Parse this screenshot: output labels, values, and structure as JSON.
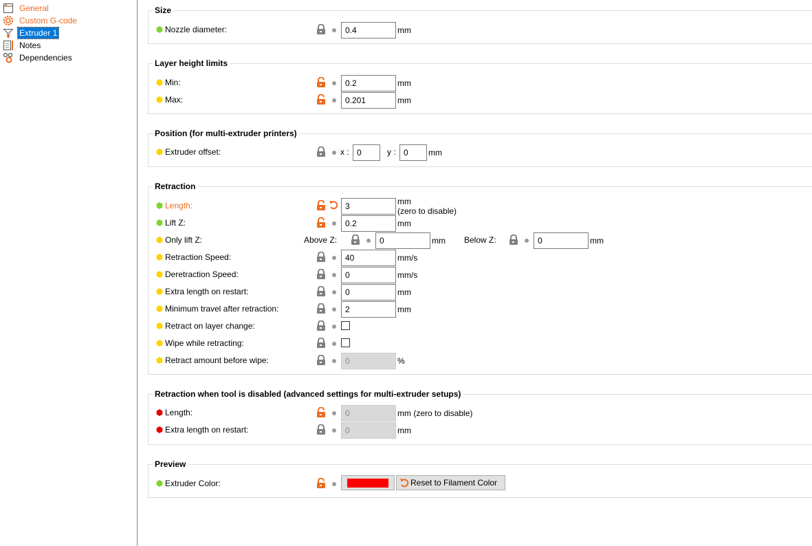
{
  "sidebar": {
    "items": [
      {
        "label": "General",
        "icon": "general-icon",
        "state": "modified"
      },
      {
        "label": "Custom G-code",
        "icon": "cog-icon",
        "state": "modified"
      },
      {
        "label": "Extruder 1",
        "icon": "extruder-icon",
        "state": "selected"
      },
      {
        "label": "Notes",
        "icon": "notes-icon",
        "state": "normal"
      },
      {
        "label": "Dependencies",
        "icon": "dependencies-icon",
        "state": "normal"
      }
    ]
  },
  "colors": {
    "accent_orange": "#ed6b21",
    "status_green": "#7fd52a",
    "status_yellow": "#ffd200",
    "status_red": "#e20000",
    "lock_gray": "#808080",
    "selection_blue": "#0078d7",
    "extruder_color": "#ff0000"
  },
  "groups": {
    "size": {
      "title": "Size",
      "nozzle_diameter": {
        "label": "Nozzle diameter:",
        "value": "0.4",
        "unit": "mm",
        "status": "green",
        "lock": "locked"
      }
    },
    "layer_height": {
      "title": "Layer height limits",
      "min": {
        "label": "Min:",
        "value": "0.2",
        "unit": "mm",
        "status": "yellow",
        "lock": "unlocked"
      },
      "max": {
        "label": "Max:",
        "value": "0.201",
        "unit": "mm",
        "status": "yellow",
        "lock": "unlocked"
      }
    },
    "position": {
      "title": "Position (for multi-extruder printers)",
      "extruder_offset": {
        "label": "Extruder offset:",
        "x_label": "x :",
        "x_value": "0",
        "y_label": "y :",
        "y_value": "0",
        "unit": "mm",
        "status": "yellow",
        "lock": "locked"
      }
    },
    "retraction": {
      "title": "Retraction",
      "length": {
        "label": "Length:",
        "value": "3",
        "unit": "mm",
        "unit_note": "(zero to disable)",
        "status": "green",
        "lock": "unlocked",
        "modified": true
      },
      "lift_z": {
        "label": "Lift Z:",
        "value": "0.2",
        "unit": "mm",
        "status": "green",
        "lock": "unlocked"
      },
      "only_lift_z": {
        "label": "Only lift Z:",
        "above_label": "Above Z:",
        "above_value": "0",
        "above_unit": "mm",
        "below_label": "Below Z:",
        "below_value": "0",
        "below_unit": "mm",
        "status": "yellow"
      },
      "retraction_speed": {
        "label": "Retraction Speed:",
        "value": "40",
        "unit": "mm/s",
        "status": "yellow",
        "lock": "locked"
      },
      "deretraction_speed": {
        "label": "Deretraction Speed:",
        "value": "0",
        "unit": "mm/s",
        "status": "yellow",
        "lock": "locked"
      },
      "extra_length": {
        "label": "Extra length on restart:",
        "value": "0",
        "unit": "mm",
        "status": "yellow",
        "lock": "locked"
      },
      "min_travel": {
        "label": "Minimum travel after retraction:",
        "value": "2",
        "unit": "mm",
        "status": "yellow",
        "lock": "locked"
      },
      "retract_layer_change": {
        "label": "Retract on layer change:",
        "checked": false,
        "status": "yellow",
        "lock": "locked"
      },
      "wipe": {
        "label": "Wipe while retracting:",
        "checked": false,
        "status": "yellow",
        "lock": "locked"
      },
      "retract_before_wipe": {
        "label": "Retract amount before wipe:",
        "value": "0",
        "unit": "%",
        "status": "yellow",
        "lock": "locked",
        "disabled": true
      }
    },
    "retraction_disabled": {
      "title": "Retraction when tool is disabled (advanced settings for multi-extruder setups)",
      "length": {
        "label": "Length:",
        "value": "0",
        "unit": "mm (zero to disable)",
        "status": "red",
        "lock": "unlocked",
        "disabled": true
      },
      "extra_length": {
        "label": "Extra length on restart:",
        "value": "0",
        "unit": "mm",
        "status": "red",
        "lock": "locked",
        "disabled": true
      }
    },
    "preview": {
      "title": "Preview",
      "extruder_color": {
        "label": "Extruder Color:",
        "status": "green",
        "lock": "unlocked",
        "reset_label": "Reset to Filament Color"
      }
    }
  }
}
